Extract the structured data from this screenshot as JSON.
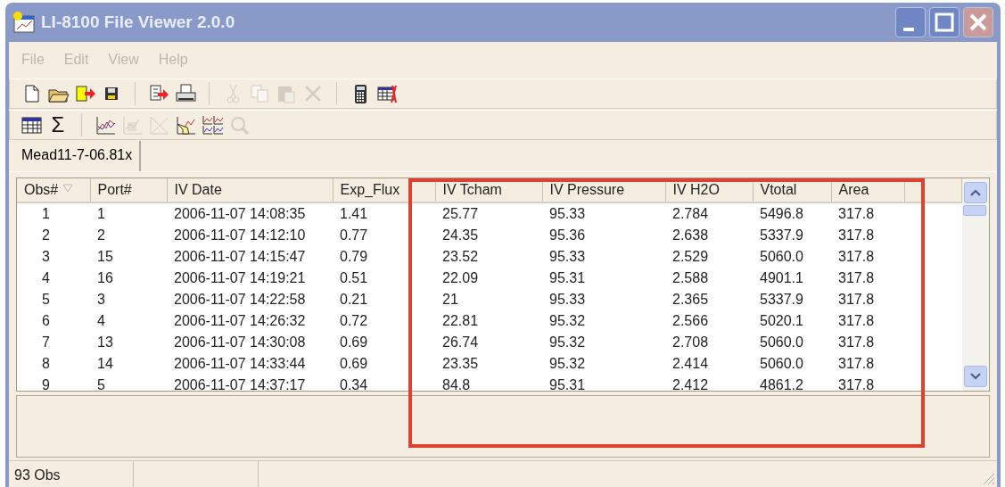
{
  "window": {
    "title": "LI-8100 File Viewer 2.0.0"
  },
  "menu": [
    {
      "label": "File",
      "disabled": true
    },
    {
      "label": "Edit",
      "disabled": true
    },
    {
      "label": "View",
      "disabled": true
    },
    {
      "label": "Help",
      "disabled": true
    }
  ],
  "toolbars": [
    [
      {
        "kind": "new",
        "disabled": false
      },
      {
        "kind": "open",
        "disabled": false
      },
      {
        "kind": "import",
        "disabled": false
      },
      {
        "kind": "save",
        "disabled": false
      },
      {
        "kind": "sep"
      },
      {
        "kind": "export",
        "disabled": false
      },
      {
        "kind": "print",
        "disabled": false
      },
      {
        "kind": "sep"
      },
      {
        "kind": "cut",
        "disabled": true
      },
      {
        "kind": "copy",
        "disabled": true
      },
      {
        "kind": "paste",
        "disabled": true
      },
      {
        "kind": "delete",
        "disabled": true
      },
      {
        "kind": "sep"
      },
      {
        "kind": "calculator",
        "disabled": false
      },
      {
        "kind": "table-delete",
        "disabled": false
      }
    ],
    [
      {
        "kind": "table",
        "disabled": false
      },
      {
        "kind": "sum",
        "glyph": "Σ",
        "disabled": false
      },
      {
        "kind": "sep"
      },
      {
        "kind": "chart",
        "disabled": false
      },
      {
        "kind": "chart-edit",
        "disabled": true
      },
      {
        "kind": "chart-clear",
        "disabled": true
      },
      {
        "kind": "chart-hand",
        "disabled": false
      },
      {
        "kind": "chart-grid",
        "disabled": false
      },
      {
        "kind": "chart-zoom",
        "disabled": true
      }
    ]
  ],
  "tabs": [
    {
      "label": "Mead11-7-06.81x",
      "selected": true
    }
  ],
  "table": {
    "columns": [
      {
        "label": "Obs#",
        "sorted": true
      },
      {
        "label": "Port#",
        "sorted": false
      },
      {
        "label": "IV Date",
        "sorted": false
      },
      {
        "label": "Exp_Flux",
        "sorted": false
      },
      {
        "label": "IV Tcham",
        "sorted": false
      },
      {
        "label": "IV Pressure",
        "sorted": false
      },
      {
        "label": "IV H2O",
        "sorted": false
      },
      {
        "label": "Vtotal",
        "sorted": false
      },
      {
        "label": "Area",
        "sorted": false
      }
    ],
    "rows": [
      [
        "1",
        "1",
        "2006-11-07 14:08:35",
        "1.41",
        "25.77",
        "95.33",
        "2.784",
        "5496.8",
        "317.8"
      ],
      [
        "2",
        "2",
        "2006-11-07 14:12:10",
        "0.77",
        "24.35",
        "95.36",
        "2.638",
        "5337.9",
        "317.8"
      ],
      [
        "3",
        "15",
        "2006-11-07 14:15:47",
        "0.79",
        "23.52",
        "95.33",
        "2.529",
        "5060.0",
        "317.8"
      ],
      [
        "4",
        "16",
        "2006-11-07 14:19:21",
        "0.51",
        "22.09",
        "95.31",
        "2.588",
        "4901.1",
        "317.8"
      ],
      [
        "5",
        "3",
        "2006-11-07 14:22:58",
        "0.21",
        "21",
        "95.33",
        "2.365",
        "5337.9",
        "317.8"
      ],
      [
        "6",
        "4",
        "2006-11-07 14:26:32",
        "0.72",
        "22.81",
        "95.32",
        "2.566",
        "5020.1",
        "317.8"
      ],
      [
        "7",
        "13",
        "2006-11-07 14:30:08",
        "0.69",
        "26.74",
        "95.32",
        "2.708",
        "5060.0",
        "317.8"
      ],
      [
        "8",
        "14",
        "2006-11-07 14:33:44",
        "0.69",
        "23.35",
        "95.32",
        "2.414",
        "5060.0",
        "317.8"
      ],
      [
        "9",
        "5",
        "2006-11-07 14:37:17",
        "0.34",
        "84.8",
        "95.31",
        "2.412",
        "4861.2",
        "317.8"
      ]
    ]
  },
  "highlight": {
    "visible": true
  },
  "status_bar": [
    "93 Obs"
  ]
}
